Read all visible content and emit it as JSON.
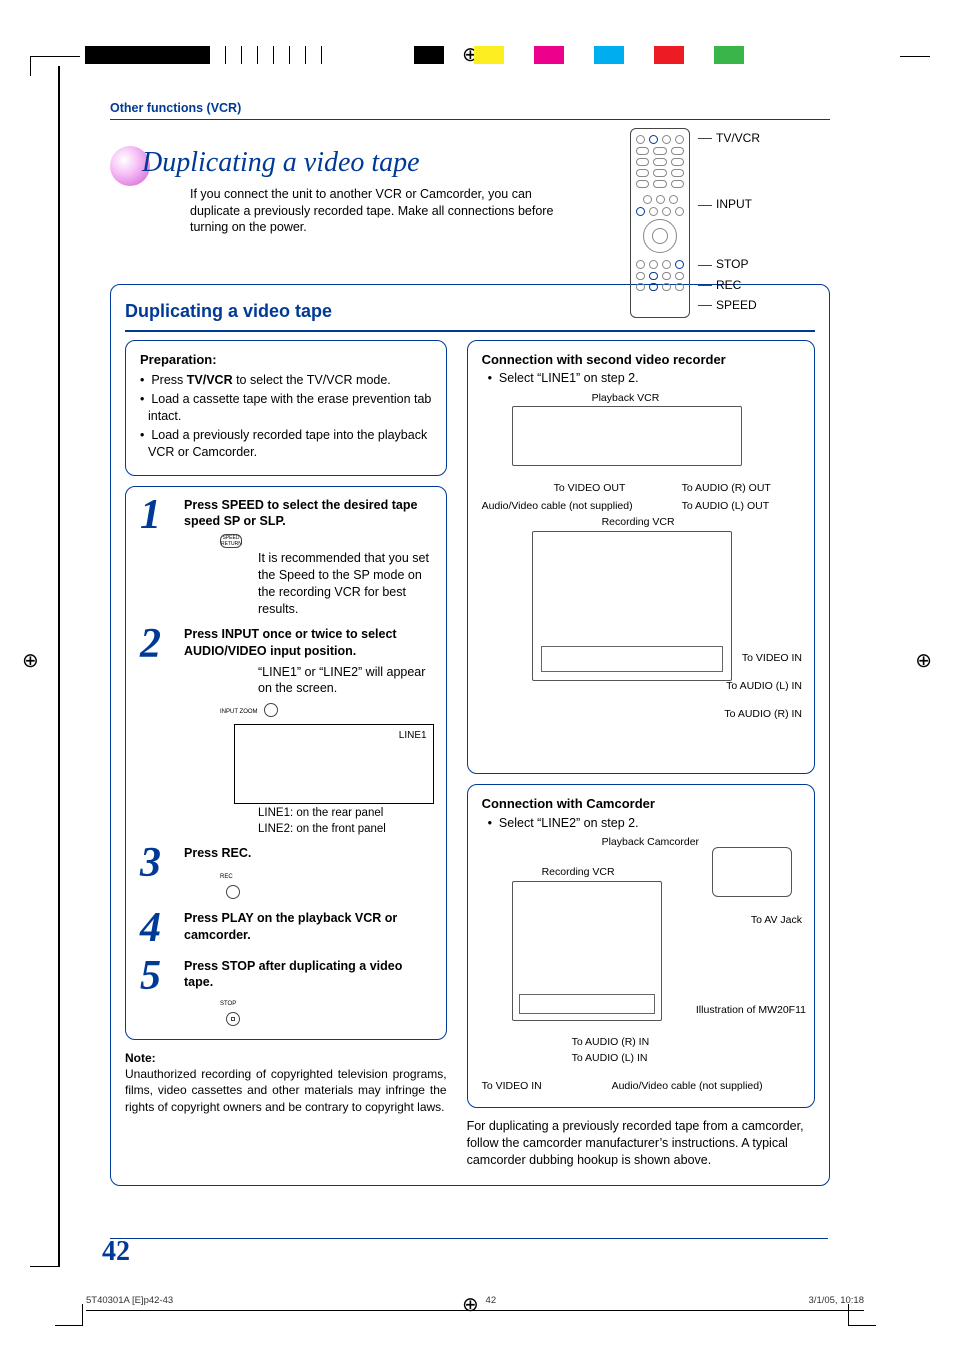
{
  "header": {
    "section_label": "Other functions (VCR)",
    "title": "Duplicating a video tape",
    "intro": "If you connect the unit to another VCR or Camcorder, you can duplicate a previously recorded tape. Make all connections before turning on the power."
  },
  "remote_labels": [
    "TV/VCR",
    "INPUT",
    "STOP",
    "REC",
    "SPEED"
  ],
  "mainbox_title": "Duplicating a video tape",
  "preparation": {
    "heading": "Preparation:",
    "items": [
      "Press TV/VCR to select the TV/VCR mode.",
      "Load a cassette tape with the erase prevention tab intact.",
      "Load a previously recorded tape into the playback VCR or Camcorder."
    ],
    "prep_bold_inline": "TV/VCR"
  },
  "steps": [
    {
      "num": "1",
      "lead": "Press SPEED to select the desired tape speed SP or SLP.",
      "icon_label": "SPEED\nRETURN",
      "sub": "It is recommended that you set the Speed to the SP mode on the recording VCR for best results."
    },
    {
      "num": "2",
      "lead": "Press INPUT once or twice to select AUDIO/VIDEO input position.",
      "icon_label": "INPUT\nZOOM",
      "sub": "“LINE1” or “LINE2” will appear on the screen.",
      "screen_text": "LINE1",
      "captions": [
        "LINE1: on the rear panel",
        "LINE2: on the front panel"
      ]
    },
    {
      "num": "3",
      "lead": "Press REC.",
      "icon_label": "REC"
    },
    {
      "num": "4",
      "lead": "Press PLAY on the playback VCR or camcorder."
    },
    {
      "num": "5",
      "lead": "Press STOP after duplicating a video tape.",
      "icon_label": "STOP"
    }
  ],
  "note": {
    "heading": "Note:",
    "text": "Unauthorized recording of copyrighted television programs, films, video cassettes and other materials may infringe the rights of copyright owners and be contrary to copyright laws."
  },
  "conn1": {
    "heading": "Connection with second video recorder",
    "bullet": "Select “LINE1” on step 2.",
    "labels": {
      "playback_vcr": "Playback VCR",
      "to_video_out": "To VIDEO OUT",
      "to_audio_r_out": "To AUDIO (R) OUT",
      "to_audio_l_out": "To AUDIO (L) OUT",
      "av_cable": "Audio/Video cable (not supplied)",
      "recording_vcr": "Recording VCR",
      "to_video_in": "To VIDEO IN",
      "to_audio_l_in": "To AUDIO (L) IN",
      "to_audio_r_in": "To AUDIO (R) IN"
    }
  },
  "conn2": {
    "heading": "Connection with Camcorder",
    "bullet": "Select “LINE2” on step 2.",
    "labels": {
      "playback_camcorder": "Playback Camcorder",
      "recording_vcr": "Recording VCR",
      "to_av_jack": "To AV Jack",
      "illustration": "Illustration of MW20F11",
      "to_audio_r_in": "To AUDIO (R) IN",
      "to_audio_l_in": "To AUDIO (L) IN",
      "to_video_in": "To VIDEO IN",
      "av_cable": "Audio/Video cable (not supplied)"
    },
    "paragraph": "For duplicating a previously recorded tape from a camcorder, follow the camcorder manufacturer’s instructions. A typical camcorder dubbing hookup is shown above."
  },
  "page_number": "42",
  "footer": {
    "left": "5T40301A [E]p42-43",
    "center": "42",
    "right": "3/1/05, 10:18"
  }
}
